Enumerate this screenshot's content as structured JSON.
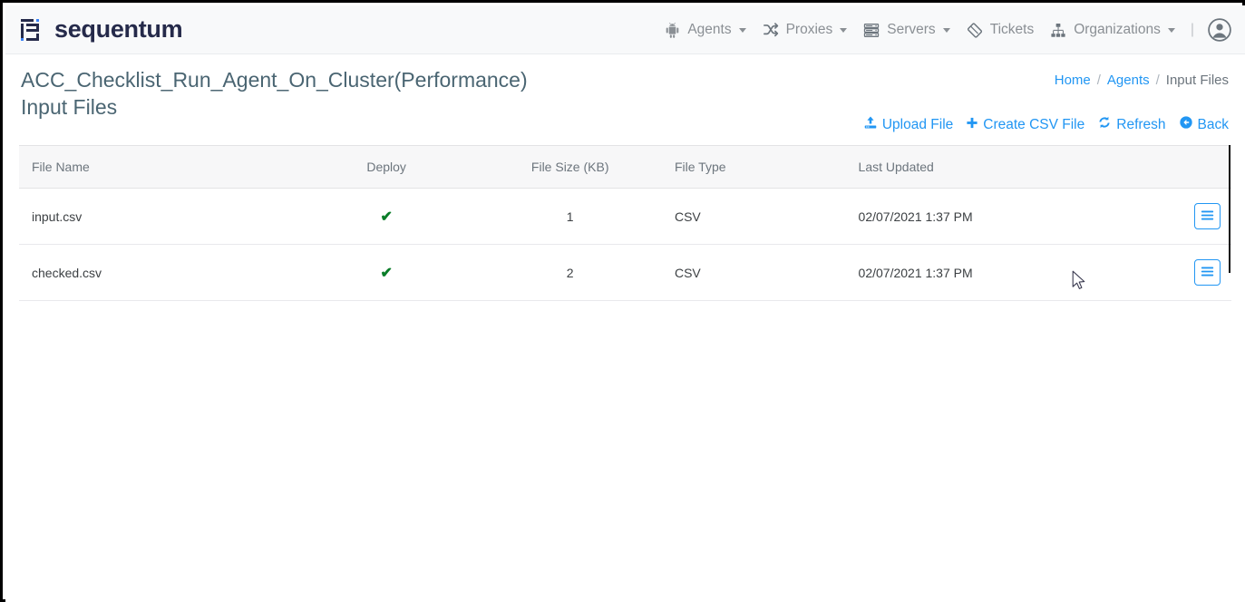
{
  "brand": {
    "name": "sequentum",
    "logo_icon": "sequentum-bracket-logo"
  },
  "nav": {
    "items": [
      {
        "label": "Agents",
        "icon": "android-robot-icon",
        "has_caret": true
      },
      {
        "label": "Proxies",
        "icon": "shuffle-icon",
        "has_caret": true
      },
      {
        "label": "Servers",
        "icon": "server-stack-icon",
        "has_caret": true
      },
      {
        "label": "Tickets",
        "icon": "ticket-icon",
        "has_caret": false
      },
      {
        "label": "Organizations",
        "icon": "sitemap-icon",
        "has_caret": true
      }
    ],
    "separator": "|",
    "avatar_icon": "user-circle-icon"
  },
  "header": {
    "title": "ACC_Checklist_Run_Agent_On_Cluster(Performance)",
    "subtitle": "Input Files"
  },
  "breadcrumb": {
    "home": "Home",
    "sep1": "/",
    "agents": "Agents",
    "sep2": "/",
    "current": "Input Files"
  },
  "toolbar": {
    "upload_label": "Upload File",
    "upload_icon": "upload-icon",
    "create_csv_label": "Create CSV File",
    "create_csv_icon": "plus-icon",
    "refresh_label": "Refresh",
    "refresh_icon": "refresh-icon",
    "back_label": "Back",
    "back_icon": "back-circle-icon"
  },
  "table": {
    "columns": [
      "File Name",
      "Deploy",
      "File Size (KB)",
      "File Type",
      "Last Updated"
    ],
    "rows": [
      {
        "file_name": "input.csv",
        "deploy": "✔",
        "file_size": "1",
        "file_type": "CSV",
        "last_updated": "02/07/2021 1:37 PM",
        "menu_icon": "hamburger-menu-icon"
      },
      {
        "file_name": "checked.csv",
        "deploy": "✔",
        "file_size": "2",
        "file_type": "CSV",
        "last_updated": "02/07/2021 1:37 PM",
        "menu_icon": "hamburger-menu-icon"
      }
    ]
  },
  "colors": {
    "brand_navy": "#252a4a",
    "link_blue": "#2196f3",
    "nav_gray": "#8a8f94",
    "title_slate": "#4a6572",
    "check_green": "#0a7d28",
    "navbar_bg": "#f8f9fa"
  }
}
